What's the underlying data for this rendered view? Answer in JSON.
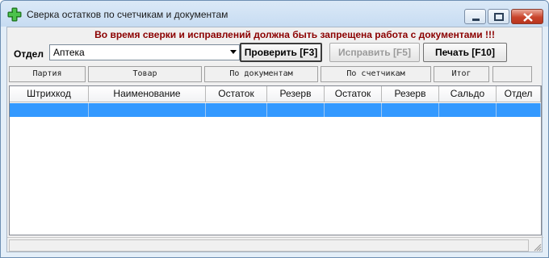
{
  "window": {
    "title": "Сверка остатков по счетчикам и документам",
    "app_icon": "green-cross-plus-icon",
    "controls": {
      "minimize": "minimize-icon",
      "maximize": "maximize-icon",
      "close": "close-icon"
    }
  },
  "warning": "Во время сверки и исправлений должна быть запрещена работа с документами !!!",
  "department": {
    "label": "Отдел",
    "value": "Аптека"
  },
  "buttons": {
    "check": "Проверить [F3]",
    "fix": "Исправить [F5]",
    "print": "Печать [F10]"
  },
  "column_groups": [
    "Партия",
    "Товар",
    "По документам",
    "По счетчикам",
    "Итог",
    ""
  ],
  "grid": {
    "columns": [
      "Штрихкод",
      "Наименование",
      "Остаток",
      "Резерв",
      "Остаток",
      "Резерв",
      "Сальдо",
      "Отдел"
    ],
    "rows": [
      [
        "",
        "",
        "",
        "",
        "",
        "",
        "",
        ""
      ]
    ]
  },
  "colors": {
    "warning": "#8b0000",
    "selection": "#3399ff",
    "titlebar": "#c7dcf2"
  }
}
